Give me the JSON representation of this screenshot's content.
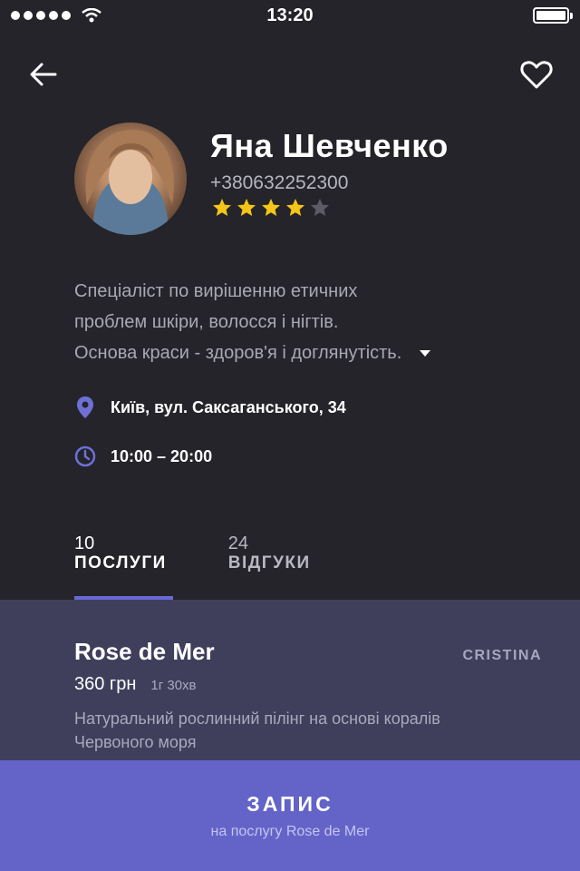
{
  "status_bar": {
    "time": "13:20"
  },
  "profile": {
    "name": "Яна Шевченко",
    "phone": "+380632252300",
    "rating": 4,
    "max_rating": 5
  },
  "description": {
    "lines": [
      "Спеціаліст по вирішенню етичних",
      "проблем шкіри, волосся і нігтів.",
      "Основа краси - здоров'я і доглянутість."
    ]
  },
  "info": {
    "address": "Київ, вул. Саксаганського, 34",
    "hours": "10:00 – 20:00"
  },
  "tabs": [
    {
      "count": "10",
      "label": "ПОСЛУГИ"
    },
    {
      "count": "24",
      "label": "ВІДГУКИ"
    }
  ],
  "service": {
    "title": "Rose de Mer",
    "master": "CRISTINA",
    "price": "360 грн",
    "duration": "1г 30хв",
    "description": "Натуральний рослинний пілінг на основі коралів Червоного моря"
  },
  "booking": {
    "label": "ЗАПИС",
    "sublabel": "на послугу Rose de Mer"
  },
  "colors": {
    "background": "#24242a",
    "accent": "#6464c8",
    "star": "#f5c518",
    "card": "#3f3f5c"
  }
}
